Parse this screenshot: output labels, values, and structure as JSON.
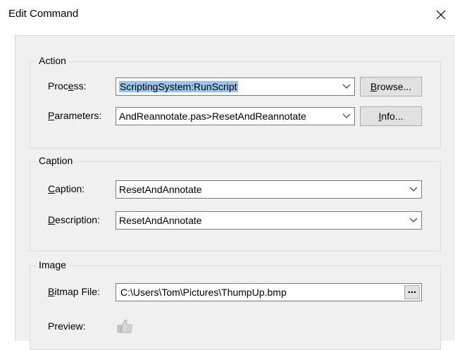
{
  "window": {
    "title": "Edit Command"
  },
  "action": {
    "group_title": "Action",
    "process_label_pre": "Proc",
    "process_label_accel": "e",
    "process_label_post": "ss:",
    "process_value": "ScriptingSystem:RunScript",
    "browse_pre": "",
    "browse_accel": "B",
    "browse_post": "rowse...",
    "parameters_label_pre": "",
    "parameters_label_accel": "P",
    "parameters_label_post": "arameters:",
    "parameters_value": "AndReannotate.pas>ResetAndReannotate",
    "info_pre": "",
    "info_accel": "I",
    "info_post": "nfo..."
  },
  "caption": {
    "group_title": "Caption",
    "caption_label_pre": "",
    "caption_label_accel": "C",
    "caption_label_post": "aption:",
    "caption_value": "ResetAndAnnotate",
    "description_label_pre": "",
    "description_label_accel": "D",
    "description_label_post": "escription:",
    "description_value": "ResetAndAnnotate"
  },
  "image": {
    "group_title": "Image",
    "bitmap_label_pre": "",
    "bitmap_label_accel": "B",
    "bitmap_label_post": "itmap File:",
    "bitmap_value": "C:\\Users\\Tom\\Pictures\\ThumpUp.bmp",
    "ellipsis": "⋯",
    "preview_label": "Preview:"
  },
  "icons": {
    "close": "close-icon",
    "dropdown": "chevron-down-icon",
    "preview": "thumbs-up-icon"
  },
  "colors": {
    "selection": "#99c5ed",
    "dialog_bg": "#f0f0f0"
  }
}
